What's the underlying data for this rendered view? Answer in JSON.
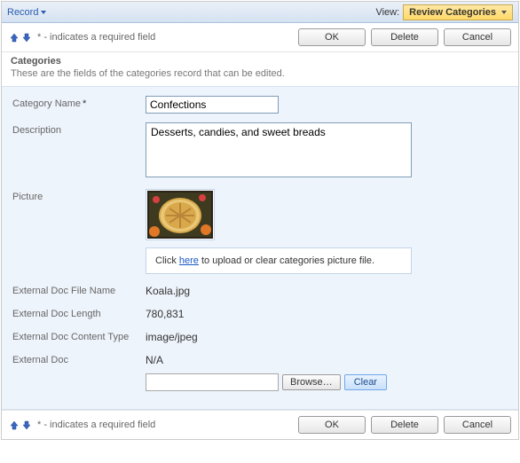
{
  "topbar": {
    "record_label": "Record",
    "view_label": "View:",
    "view_value": "Review Categories"
  },
  "actions": {
    "required_note": "* - indicates a required field",
    "ok": "OK",
    "delete": "Delete",
    "cancel": "Cancel"
  },
  "section": {
    "title": "Categories",
    "desc": "These are the fields of the categories record that can be edited."
  },
  "form": {
    "category_name_label": "Category Name",
    "category_name_value": "Confections",
    "description_label": "Description",
    "description_value": "Desserts, candies, and sweet breads",
    "picture_label": "Picture",
    "upload_prefix": "Click ",
    "upload_link": "here",
    "upload_suffix": " to upload or clear categories picture file.",
    "ext_file_label": "External Doc File Name",
    "ext_file_value": "Koala.jpg",
    "ext_len_label": "External Doc Length",
    "ext_len_value": "780,831",
    "ext_ct_label": "External Doc Content Type",
    "ext_ct_value": "image/jpeg",
    "ext_doc_label": "External Doc",
    "ext_doc_value": "N/A",
    "browse_label": "Browse…",
    "clear_label": "Clear"
  }
}
